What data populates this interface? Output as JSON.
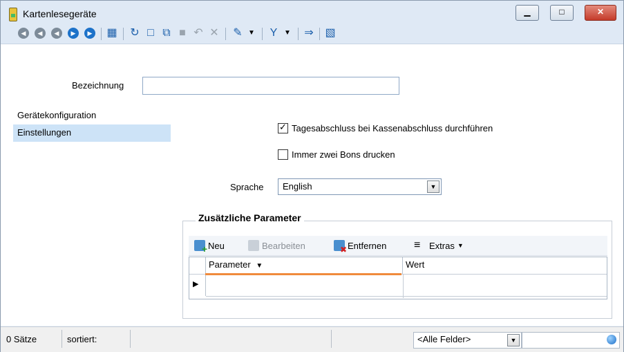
{
  "window": {
    "title": "Kartenlesegeräte",
    "controls": {
      "minimize": "▁",
      "maximize": "□",
      "close": "✕"
    }
  },
  "toolbar": {
    "icons": [
      "first-record-icon",
      "prev-page-icon",
      "prev-record-icon",
      "next-record-icon",
      "last-record-icon",
      "table-view-icon",
      "refresh-icon",
      "new-doc-icon",
      "copy-icon",
      "save-icon",
      "undo-icon",
      "delete-icon",
      "tools-icon",
      "dropdown-icon",
      "filter-icon",
      "dropdown-icon",
      "export-icon",
      "book-icon"
    ]
  },
  "form": {
    "bezeichnung_label": "Bezeichnung",
    "bezeichnung_value": ""
  },
  "nav": {
    "items": [
      {
        "label": "Gerätekonfiguration"
      },
      {
        "label": "Einstellungen",
        "selected": true
      }
    ]
  },
  "settings": {
    "tagesabschluss_label": "Tagesabschluss bei Kassenabschluss durchführen",
    "tagesabschluss_checked": true,
    "zwei_bons_label": "Immer zwei Bons drucken",
    "zwei_bons_checked": false,
    "sprache_label": "Sprache",
    "sprache_value": "English"
  },
  "params": {
    "group_title": "Zusätzliche Parameter",
    "toolbar": {
      "neu": "Neu",
      "bearbeiten": "Bearbeiten",
      "entfernen": "Entfernen",
      "extras": "Extras"
    },
    "columns": [
      "Parameter",
      "Wert"
    ],
    "sort_indicator": "▼",
    "row_marker": "▶"
  },
  "statusbar": {
    "count": "0 Sätze",
    "sorted": "sortiert:",
    "field_filter": "<Alle Felder>"
  },
  "colors": {
    "accent": "#1d72c9",
    "selection": "#cde3f7",
    "sort_line": "#f08a3c"
  }
}
